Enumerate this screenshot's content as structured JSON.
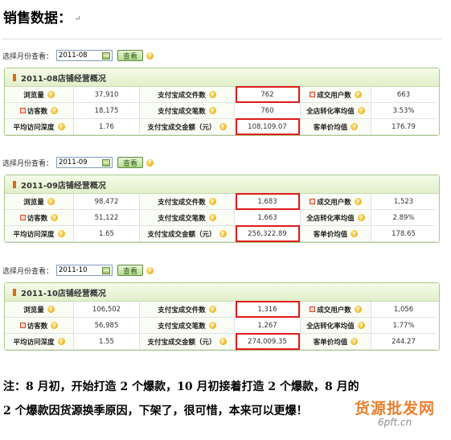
{
  "heading": "销售数据：",
  "select_label": "选择月份查看：",
  "query_label": "查看",
  "months": [
    {
      "selected": "2011-08",
      "title": "2011-08店铺经营概况",
      "rows": [
        [
          "浏览量",
          "37,910",
          "支付宝成交件数",
          "762",
          "成交用户数",
          "663"
        ],
        [
          "访客数",
          "18,175",
          "支付宝成交笔数",
          "760",
          "全店转化率均值",
          "3.53%"
        ],
        [
          "平均访问深度",
          "1.76",
          "支付宝成交金额（元）",
          "108,109.07",
          "客单价均值",
          "176.79"
        ]
      ]
    },
    {
      "selected": "2011-09",
      "title": "2011-09店铺经营概况",
      "rows": [
        [
          "浏览量",
          "98,472",
          "支付宝成交件数",
          "1,683",
          "成交用户数",
          "1,523"
        ],
        [
          "访客数",
          "51,122",
          "支付宝成交笔数",
          "1,663",
          "全店转化率均值",
          "2.89%"
        ],
        [
          "平均访问深度",
          "1.65",
          "支付宝成交金额（元）",
          "256,322.89",
          "客单价均值",
          "178.65"
        ]
      ]
    },
    {
      "selected": "2011-10",
      "title": "2011-10店铺经营概况",
      "rows": [
        [
          "浏览量",
          "106,502",
          "支付宝成交件数",
          "1,316",
          "成交用户数",
          "1,056"
        ],
        [
          "访客数",
          "56,985",
          "支付宝成交笔数",
          "1,267",
          "全店转化率均值",
          "1.77%"
        ],
        [
          "平均访问深度",
          "1.55",
          "支付宝成交金额（元）",
          "274,009.35",
          "客单价均值",
          "244.27"
        ]
      ]
    }
  ],
  "note_line1": "注：8 月初，开始打造 2 个爆款，10 月初接着打造 2 个爆款，8 月的",
  "note_line2": "2 个爆款因货源换季原因，下架了，很可惜，本来可以更爆！",
  "watermark": "货源批发网",
  "watermark_url": "6pft.cn",
  "colors": {
    "highlight": "#e01b1b",
    "panel_border": "#a9c98b",
    "query_green": "#2f5e16"
  }
}
